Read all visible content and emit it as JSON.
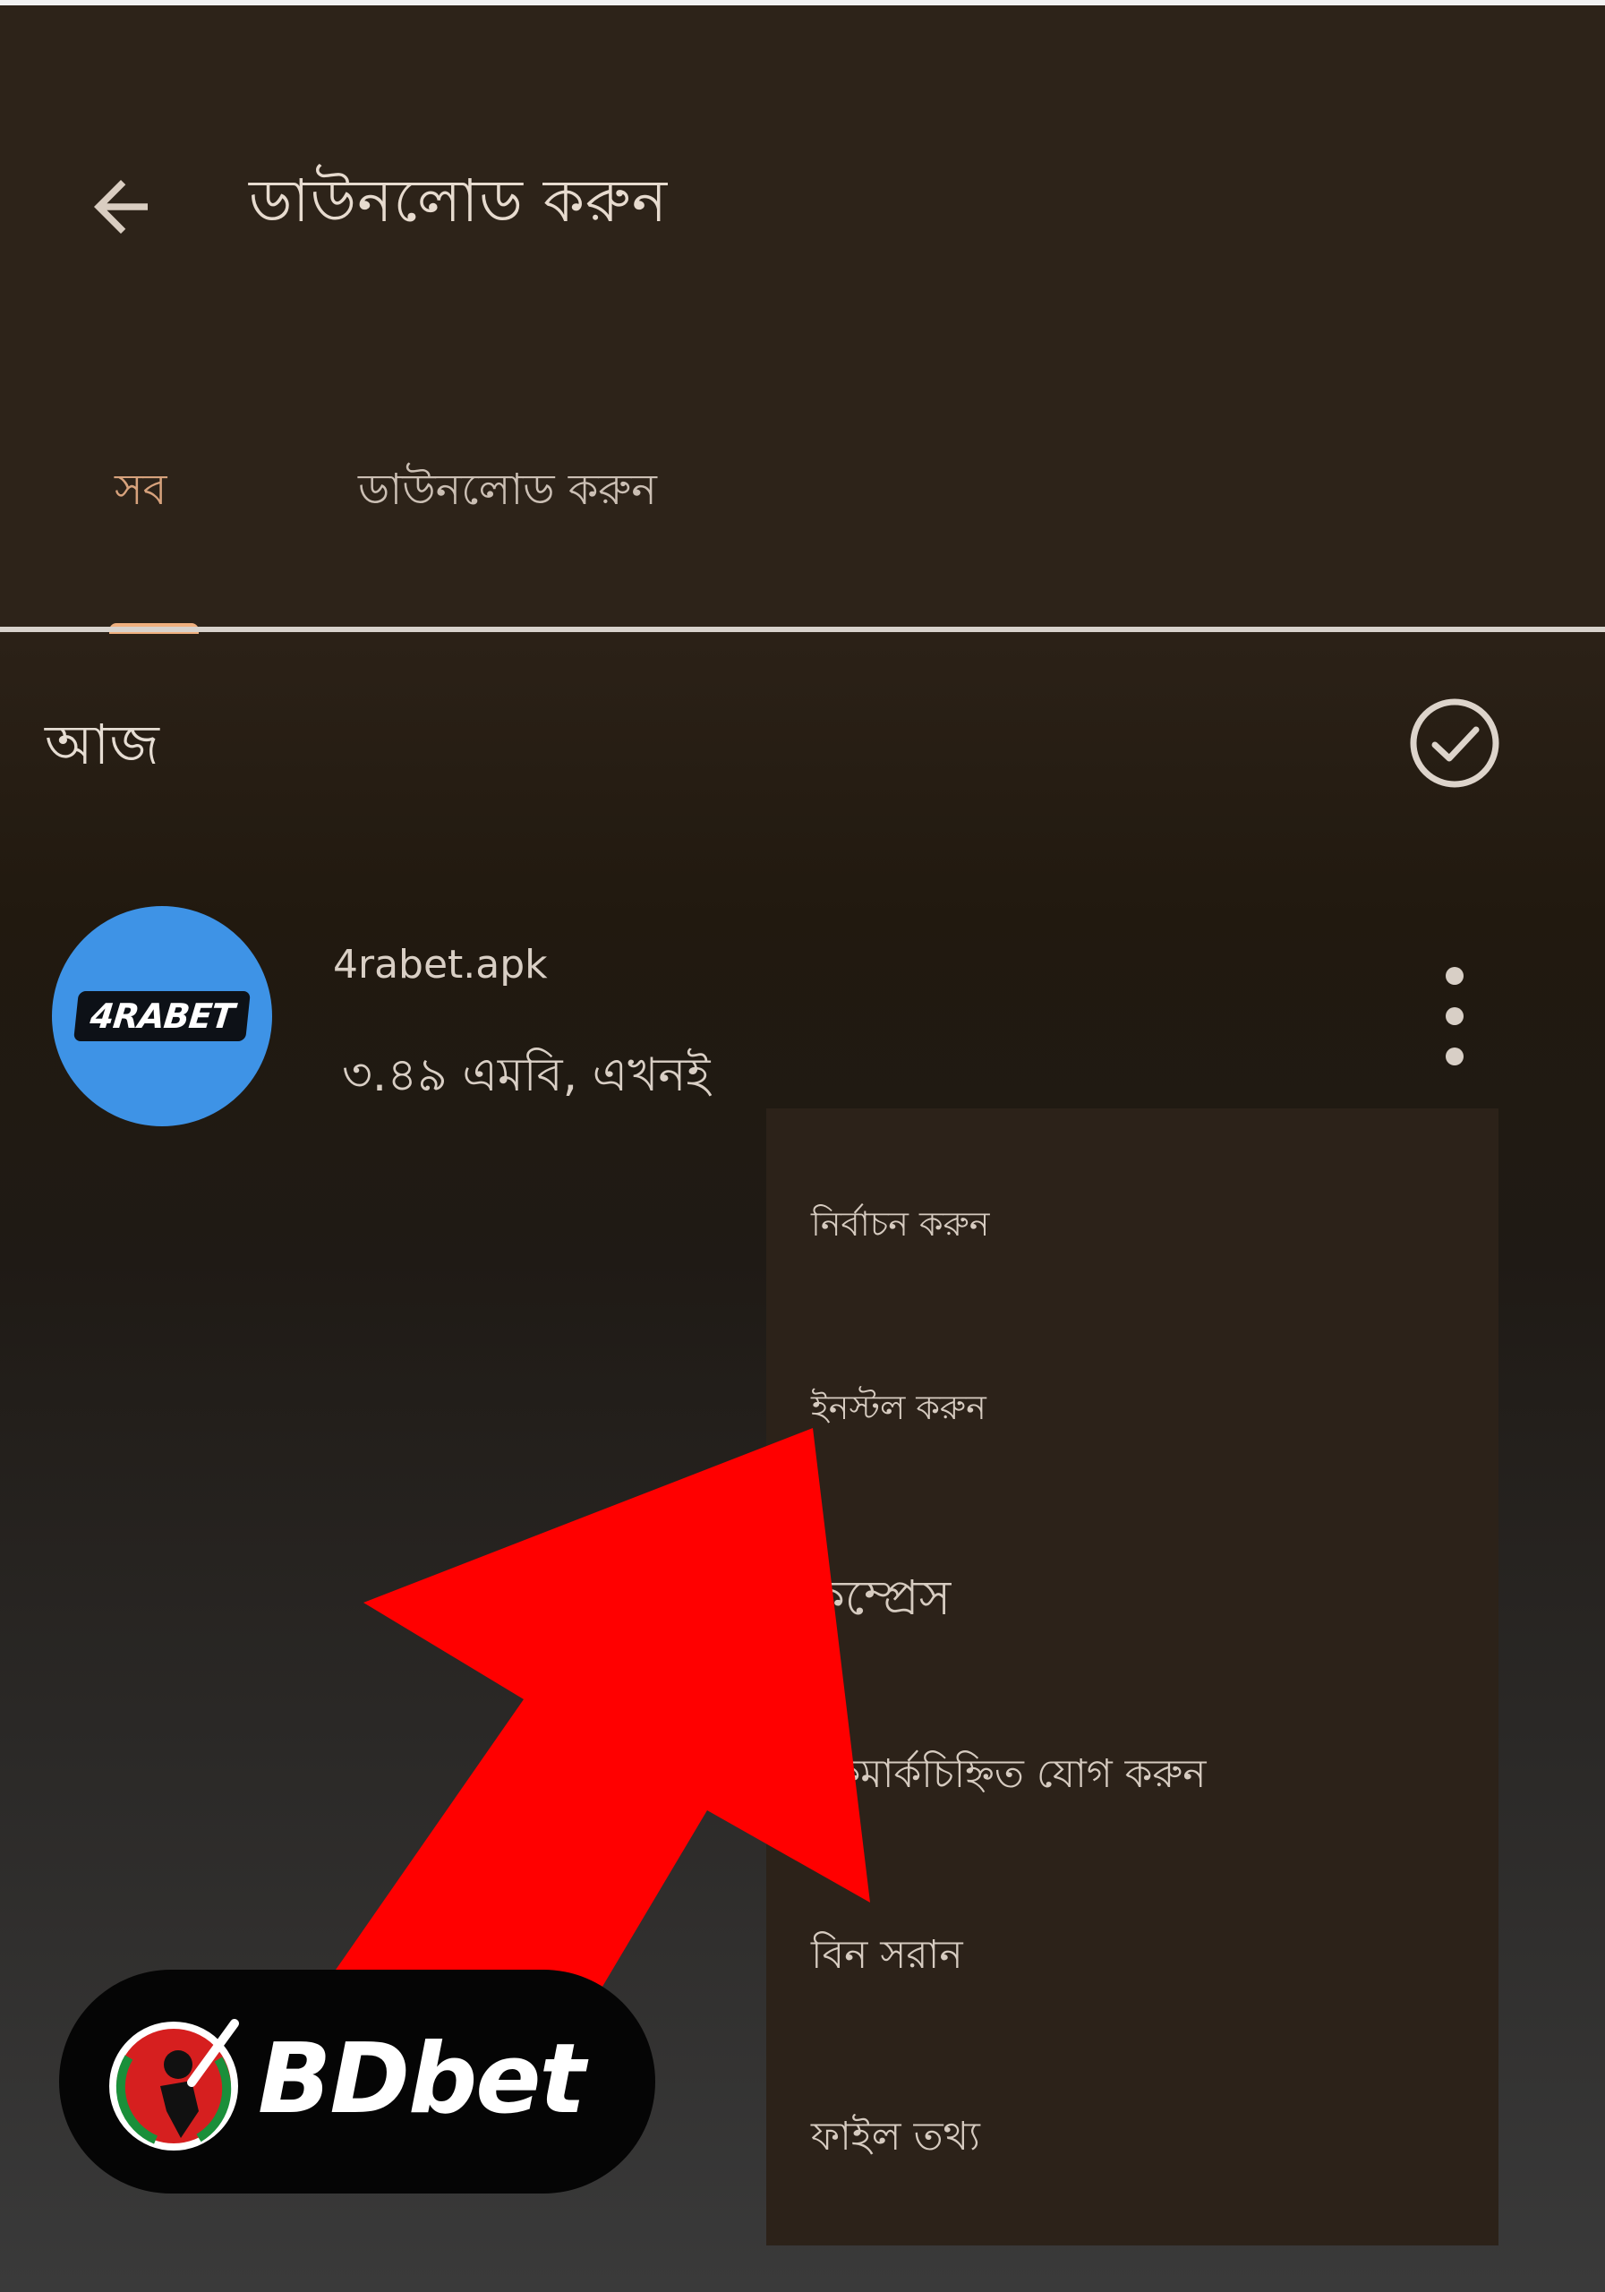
{
  "header": {
    "title": "ডাউনলোড করুন",
    "back_icon": "arrow-left-icon"
  },
  "tabs": [
    {
      "label": "সব",
      "active": true
    },
    {
      "label": "ডাউনলোড করুন",
      "active": false
    }
  ],
  "colors": {
    "accent": "#f0b07f",
    "app_icon_bg": "#3e93e6",
    "arrow": "#ff0000"
  },
  "section": {
    "title": "আজ",
    "select_icon": "check-circle-icon"
  },
  "file": {
    "logo_text": "4RABET",
    "name": "4rabet.apk",
    "meta": "৩.৪৯ এমবি, এখনই",
    "more_icon": "more-vertical-icon"
  },
  "menu": {
    "items": [
      {
        "label": "নির্বাচন করুন"
      },
      {
        "label": "ইনস্টল করুন"
      },
      {
        "label": "কম্প্রেস"
      },
      {
        "label": "বুকমার্কচিহ্নিত যোগ করুন"
      },
      {
        "label": "বিন সরান"
      },
      {
        "label": "ফাইল তথ্য"
      }
    ]
  },
  "brand": {
    "text": "BDbet"
  }
}
